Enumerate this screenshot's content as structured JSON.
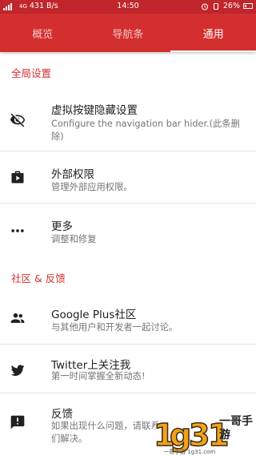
{
  "status_bar": {
    "carrier": "4G",
    "network_speed": "431 B/s",
    "time": "14:50",
    "battery": "26%"
  },
  "tabs": [
    {
      "label": "概览",
      "active": false
    },
    {
      "label": "导航条",
      "active": false
    },
    {
      "label": "通用",
      "active": true
    }
  ],
  "sections": {
    "global": "全局设置",
    "community": "社区 & 反馈"
  },
  "items": [
    {
      "icon": "eye-off-icon",
      "title": "虚拟按键隐藏设置",
      "subtitle": "Configure the navigation bar hider.(此条删除)"
    },
    {
      "icon": "shop-bag-icon",
      "title": "外部权限",
      "subtitle": "管理外部应用权限。"
    },
    {
      "icon": "more-horiz-icon",
      "title": "更多",
      "subtitle": "调整和修复"
    },
    {
      "icon": "group-icon",
      "title": "Google Plus社区",
      "subtitle": "与其他用户和开发者一起讨论。"
    },
    {
      "icon": "twitter-icon",
      "title": "Twitter上关注我",
      "subtitle": "第一时间掌握全新动态!"
    },
    {
      "icon": "feedback-icon",
      "title": "反馈",
      "subtitle": "如果出现什么问题，请联系我们解决。"
    }
  ],
  "watermark": {
    "logo": "1g31",
    "brand": "一哥手游",
    "url": "一哥手游 1g31.com"
  },
  "colors": {
    "status_bar": "#c0262b",
    "app_bar": "#d32f2f",
    "accent": "#d32f2f",
    "icon": "#212121"
  }
}
